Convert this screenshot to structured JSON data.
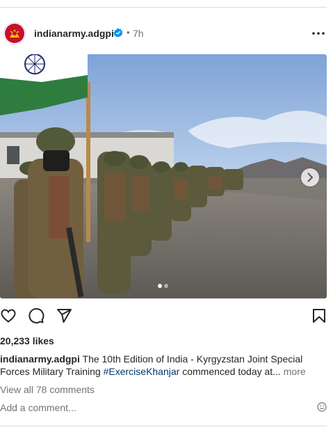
{
  "post": {
    "username": "indianarmy.adgpi",
    "separator": "•",
    "time": "7h",
    "likes": "20,233 likes",
    "caption": {
      "username": "indianarmy.adgpi",
      "text": " The 10th Edition of India - Kyrgyzstan Joint Special Forces Military Training ",
      "hashtag": "#ExerciseKhanjar",
      "text_after": " commenced today at...",
      "more": " more"
    },
    "view_comments": "View all 78 comments",
    "add_comment_placeholder": "Add a comment...",
    "carousel": {
      "current": 1,
      "total": 2
    }
  },
  "icons": {
    "verified": "verified-badge-icon",
    "more": "more-options-icon",
    "like": "heart-icon",
    "comment": "comment-icon",
    "share": "paper-plane-icon",
    "save": "bookmark-icon",
    "next": "chevron-right-icon",
    "emoji": "emoji-icon"
  },
  "colors": {
    "verified": "#0095f6",
    "hashtag": "#00376b",
    "muted": "#737373",
    "text": "#262626"
  }
}
